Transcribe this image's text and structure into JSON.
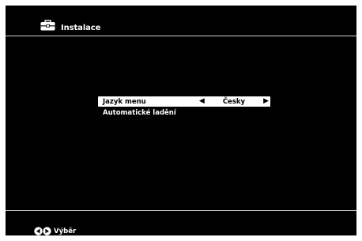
{
  "header": {
    "title": "Instalace",
    "icon": "toolbox-icon"
  },
  "menu": {
    "items": [
      {
        "label": "Jazyk menu",
        "value": "Česky",
        "selected": true
      },
      {
        "label": "Automatické ladění",
        "selected": false
      }
    ]
  },
  "footer": {
    "hint_label": "Výběr",
    "hint_icon": "left-right-arrows-icon"
  },
  "colors": {
    "background": "#000000",
    "text": "#ffffff",
    "highlight": "#ffffff",
    "highlight_text": "#000000",
    "frame": "#ffffff"
  }
}
